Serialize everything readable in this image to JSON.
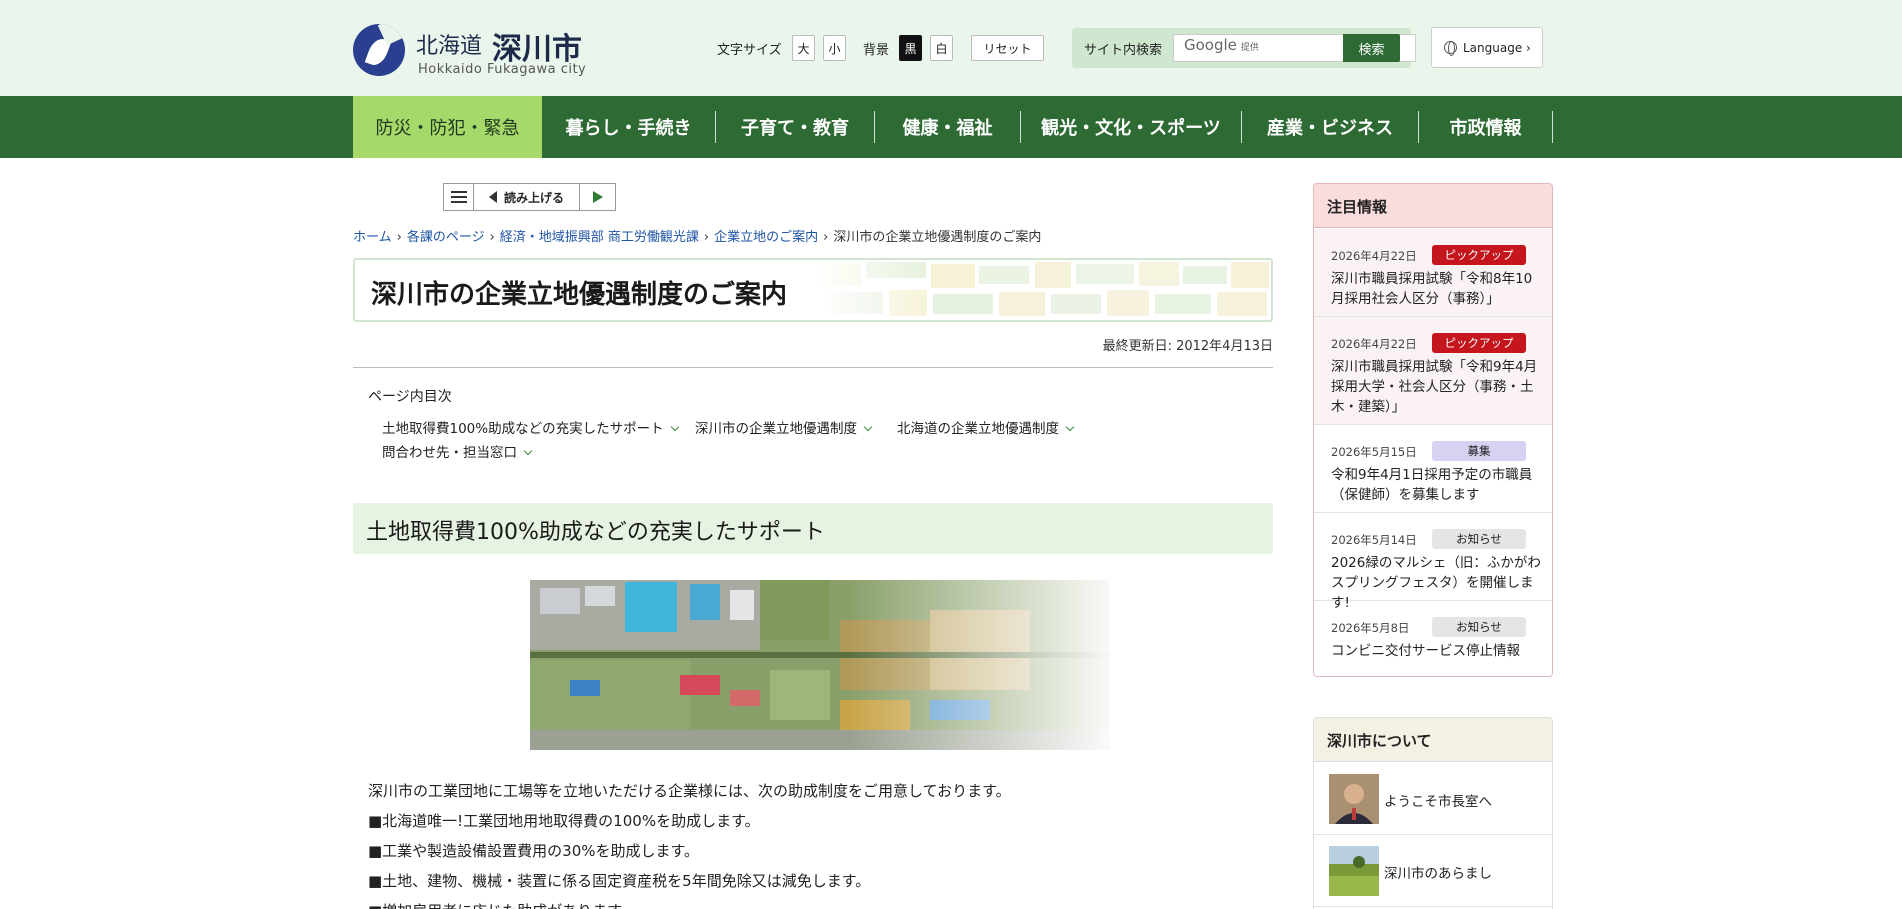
{
  "header": {
    "logo_pref": "北海道",
    "logo_city": "深川市",
    "logo_en": "Hokkaido Fukagawa city",
    "font_size_label": "文字サイズ",
    "font_large": "大",
    "font_small": "小",
    "bg_label": "背景",
    "bg_black": "黒",
    "bg_white": "白",
    "reset": "リセット",
    "search_label": "サイト内検索",
    "search_brand": "Google",
    "search_brand_sub": "提供",
    "search_button": "検索",
    "language": "Language ›"
  },
  "nav": [
    {
      "label": "防災・防犯・緊急",
      "active": true
    },
    {
      "label": "暮らし・手続き"
    },
    {
      "label": "子育て・教育"
    },
    {
      "label": "健康・福祉"
    },
    {
      "label": "観光・文化・スポーツ"
    },
    {
      "label": "産業・ビジネス"
    },
    {
      "label": "市政情報"
    }
  ],
  "reader": {
    "read_label": "読み上げる"
  },
  "breadcrumb": [
    "ホーム",
    "各課のページ",
    "経済・地域振興部 商工労働観光課",
    "企業立地のご案内",
    "深川市の企業立地優遇制度のご案内"
  ],
  "page": {
    "title": "深川市の企業立地優遇制度のご案内",
    "updated": "最終更新日: 2012年4月13日",
    "toc_title": "ページ内目次",
    "toc": [
      "土地取得費100%助成などの充実したサポート",
      "深川市の企業立地優遇制度",
      "北海道の企業立地優遇制度",
      "問合わせ先・担当窓口"
    ],
    "section_heading": "土地取得費100%助成などの充実したサポート",
    "body": [
      "深川市の工業団地に工場等を立地いただける企業様には、次の助成制度をご用意しております。",
      "■北海道唯一!工業団地用地取得費の100%を助成します。",
      "■工業や製造設備設置費用の30%を助成します。",
      "■土地、建物、機械・装置に係る固定資産税を5年間免除又は減免します。",
      "■増加雇用者に応じた助成があります。"
    ]
  },
  "notice": {
    "title": "注目情報",
    "items": [
      {
        "date": "2026年4月22日",
        "badge": "ピックアップ",
        "text": "深川市職員採用試験「令和8年10月採用社会人区分（事務）」"
      },
      {
        "date": "2026年4月22日",
        "badge": "ピックアップ",
        "text": "深川市職員採用試験「令和9年4月採用大学・社会人区分（事務・土木・建築）」"
      },
      {
        "date": "2026年5月15日",
        "badge": "募集",
        "text": "令和9年4月1日採用予定の市職員（保健師）を募集します"
      },
      {
        "date": "2026年5月14日",
        "badge": "お知らせ",
        "text": "2026緑のマルシェ（旧：ふかがわスプリングフェスタ）を開催します!"
      },
      {
        "date": "2026年5月8日",
        "badge": "お知らせ",
        "text": "コンビニ交付サービス停止情報"
      }
    ]
  },
  "about": {
    "title": "深川市について",
    "items": [
      {
        "label": "ようこそ市長室へ"
      },
      {
        "label": "深川市のあらまし"
      }
    ]
  },
  "colors": {
    "header_bg": "#eaf6ec",
    "nav_bg": "#2e6a34",
    "nav_active": "#a6d86a",
    "link": "#1f55a6",
    "badge_red": "#c4161c",
    "badge_purple": "#d6d2f2",
    "badge_gray": "#e5e5e5"
  }
}
